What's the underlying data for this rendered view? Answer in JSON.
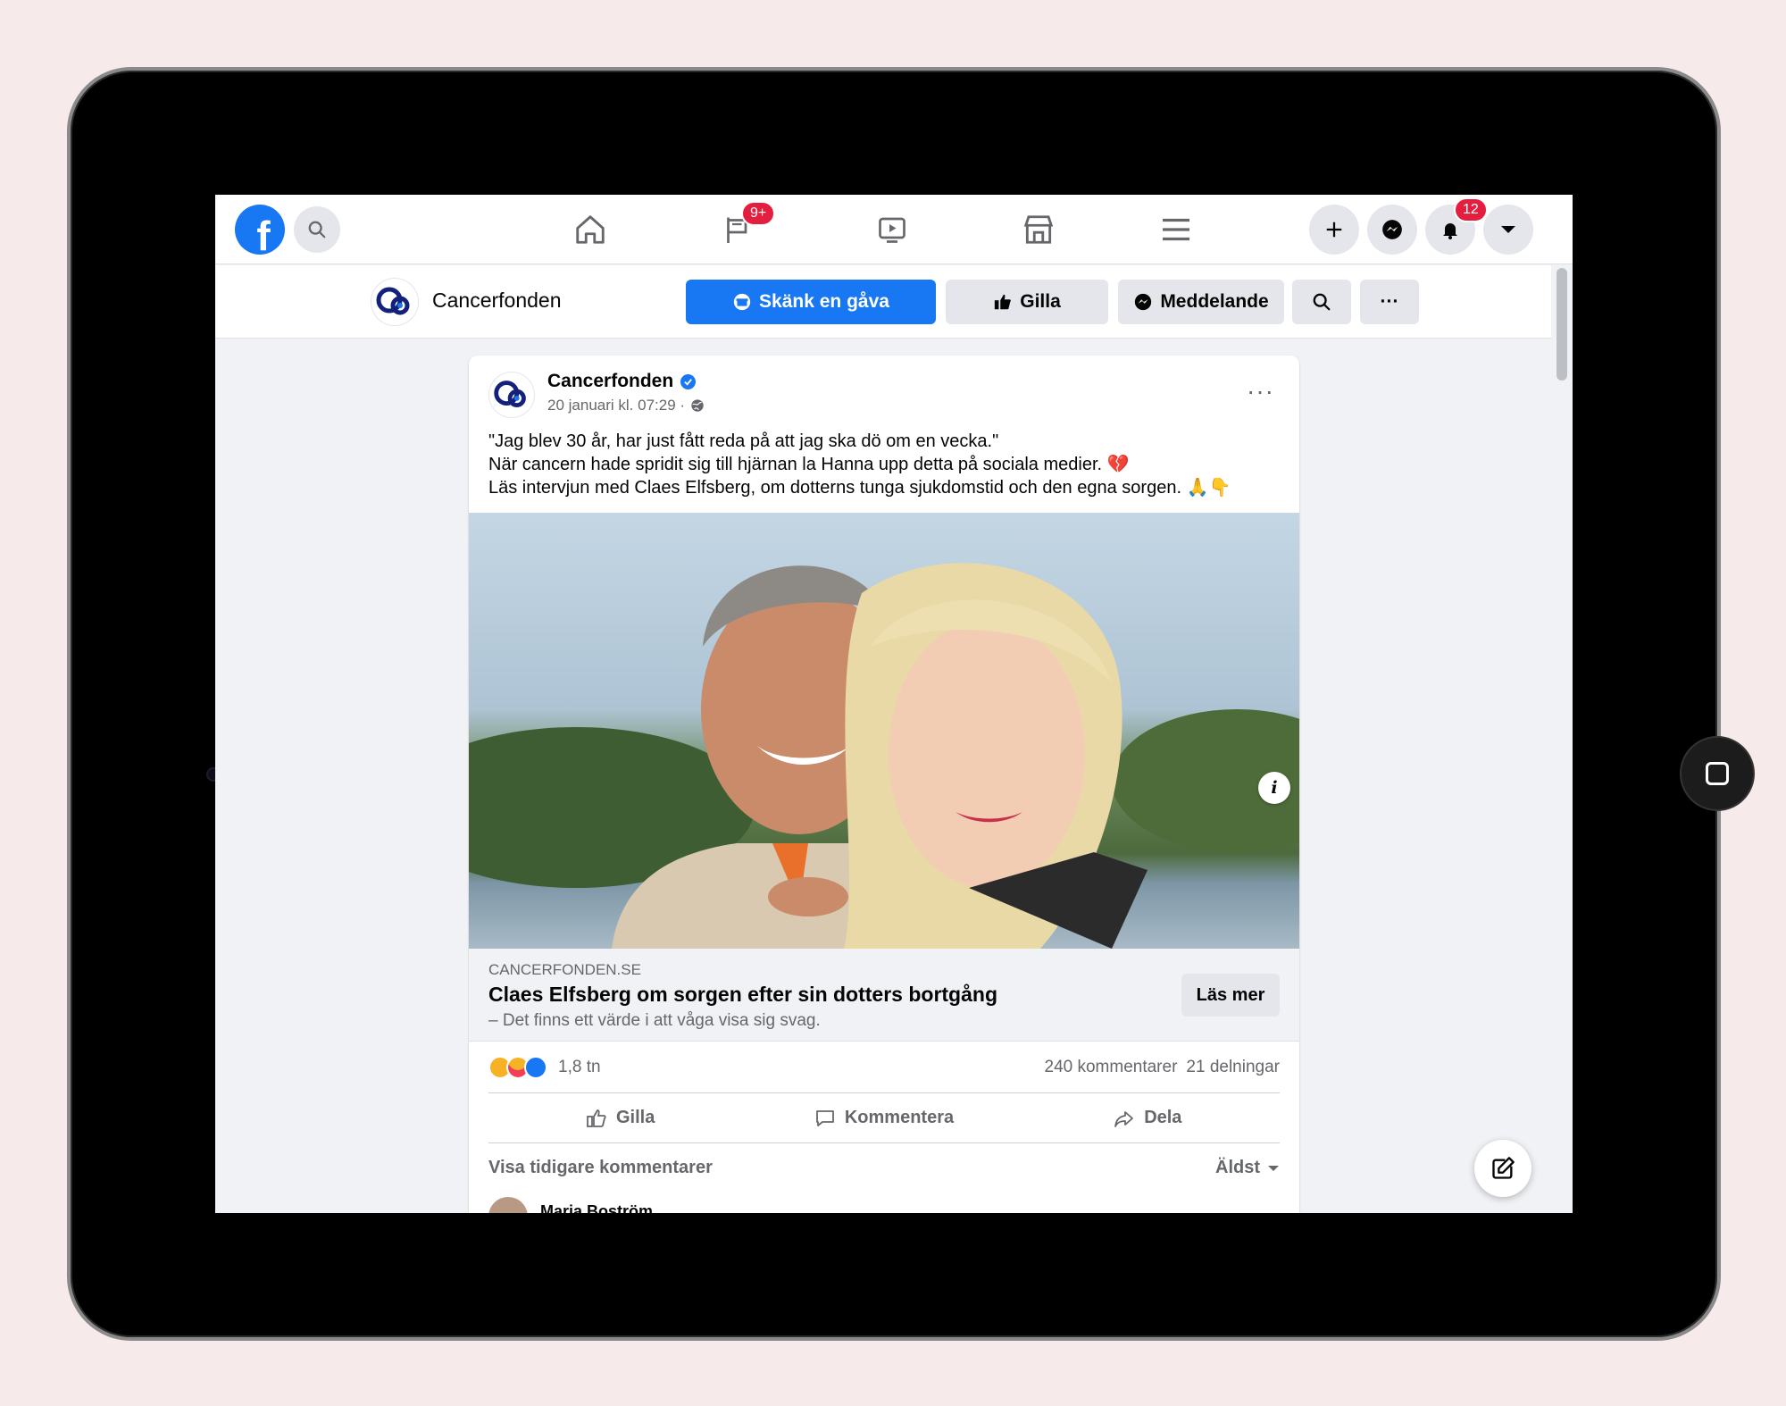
{
  "topnav": {
    "logo_letter": "f",
    "watch_badge": "9+",
    "notifications_badge": "12"
  },
  "page_header": {
    "name": "Cancerfonden",
    "donate_label": "Skänk en gåva",
    "like_label": "Gilla",
    "message_label": "Meddelande",
    "more_label": "···"
  },
  "post": {
    "author": "Cancerfonden",
    "timestamp": "20 januari kl. 07:29 ·",
    "more_label": "···",
    "text_line_1": "\"Jag blev 30 år, har just fått reda på att jag ska dö om en vecka.\"",
    "text_line_2": "När cancern hade spridit sig till hjärnan la Hanna upp detta på sociala medier. 💔",
    "text_line_3": "Läs intervjun med Claes Elfsberg, om dotterns tunga sjukdomstid och den egna sorgen. 🙏👇",
    "info_label": "i",
    "link": {
      "domain": "CANCERFONDEN.SE",
      "title": "Claes Elfsberg om sorgen efter sin dotters bortgång",
      "description": "– Det finns ett värde i att våga visa sig svag.",
      "button": "Läs mer"
    },
    "stats": {
      "reactions_count": "1,8 tn",
      "comments": "240 kommentarer",
      "shares": "21 delningar"
    },
    "actions": {
      "like": "Gilla",
      "comment": "Kommentera",
      "share": "Dela"
    },
    "comments_header": {
      "previous": "Visa tidigare kommentarer",
      "sort": "Äldst"
    },
    "first_commenter": "Maria Boström"
  },
  "colors": {
    "brand": "#1877f2",
    "badge": "#e41e3f",
    "page_bg": "#f6eaea"
  }
}
